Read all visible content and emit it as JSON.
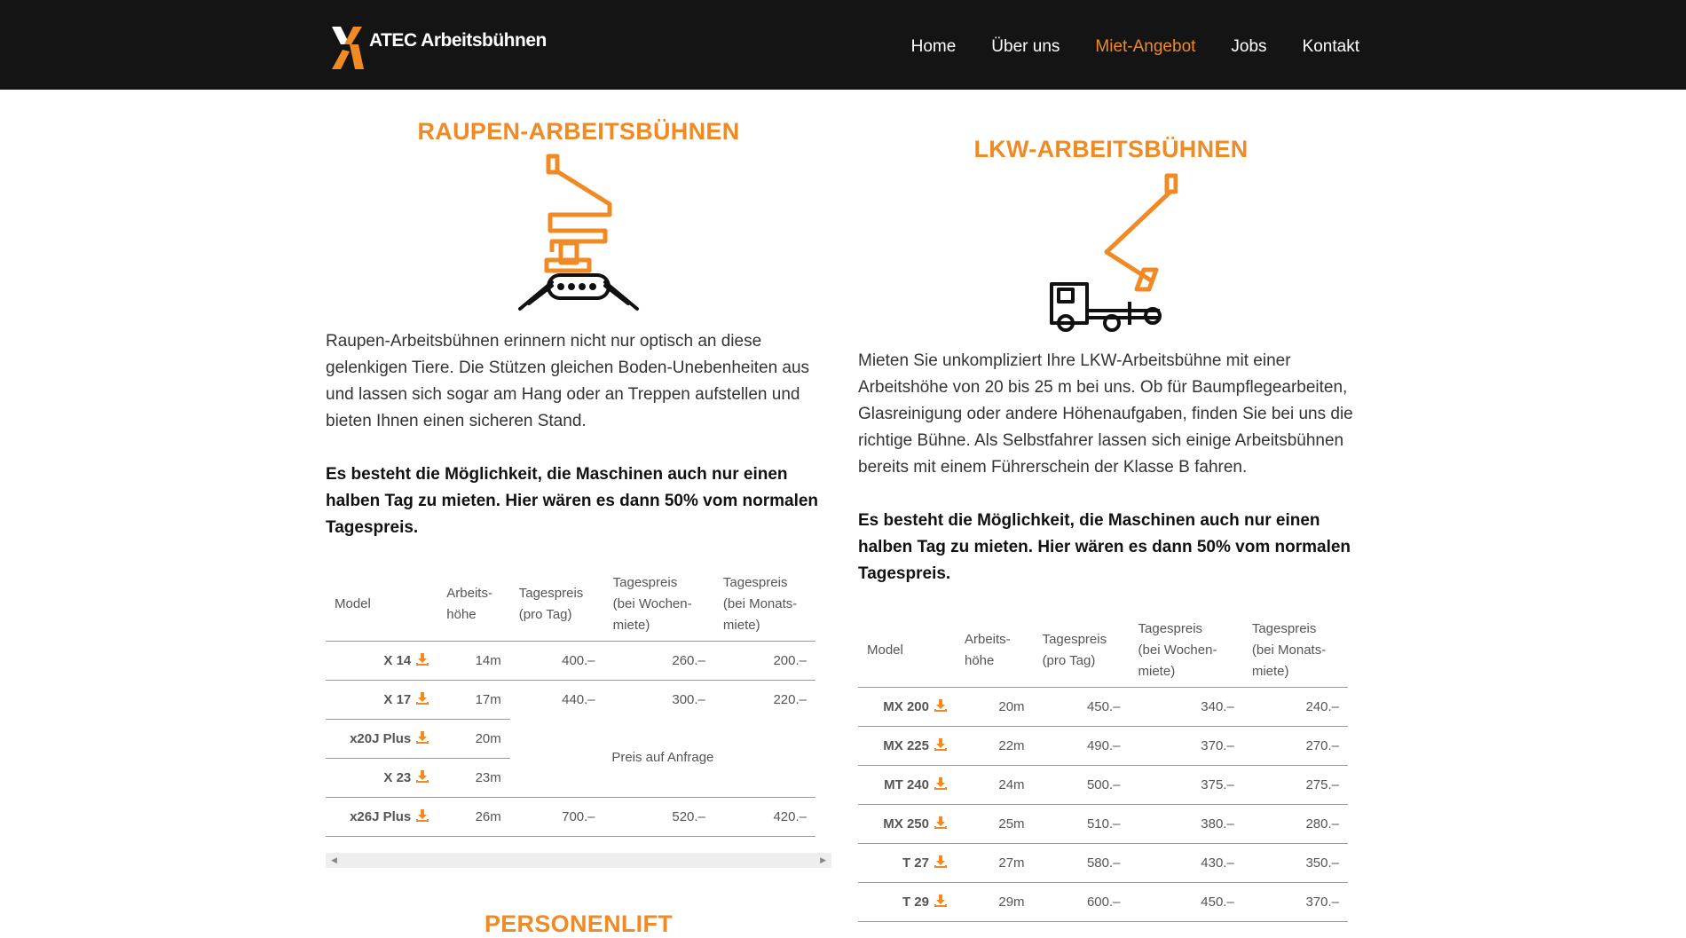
{
  "brand": {
    "name": "ATEC Arbeitsbühnen",
    "accent": "#f08a24",
    "dark": "#141414"
  },
  "nav": {
    "items": [
      {
        "label": "Home",
        "active": false
      },
      {
        "label": "Über uns",
        "active": false
      },
      {
        "label": "Miet-Angebot",
        "active": true
      },
      {
        "label": "Jobs",
        "active": false
      },
      {
        "label": "Kontakt",
        "active": false
      }
    ]
  },
  "raupen": {
    "title": "RAUPEN-ARBEITSBÜHNEN",
    "icon": "crawler-lift-icon",
    "text": "Raupen-Arbeitsbühnen erinnern nicht nur optisch an diese gelenkigen Tiere. Die Stützen gleichen Boden-Unebenheiten aus und lassen sich sogar am Hang oder an Treppen aufstellen und bieten Ihnen einen sicheren Stand.",
    "note": "Es besteht die Möglichkeit, die Maschinen auch nur einen halben Tag zu mieten. Hier wären es dann 50% vom normalen Tagespreis.",
    "table": {
      "headers": [
        "Model",
        "Arbeits-\nhöhe",
        "Tagespreis\n(pro Tag)",
        "Tagespreis\n(bei Wochen-\nmiete)",
        "Tagespreis\n(bei Monats-\nmiete)"
      ],
      "rows": [
        {
          "model": "X 14",
          "height": "14m",
          "day": "400.–",
          "week": "260.–",
          "month": "200.–"
        },
        {
          "model": "X 17",
          "height": "17m",
          "day": "440.–",
          "week": "300.–",
          "month": "220.–"
        },
        {
          "model": "x20J Plus",
          "height": "20m"
        },
        {
          "model": "X 23",
          "height": "23m"
        },
        {
          "model": "x26J Plus",
          "height": "26m",
          "day": "700.–",
          "week": "520.–",
          "month": "420.–"
        }
      ],
      "on_request": "Preis auf Anfrage"
    }
  },
  "lkw": {
    "title": "LKW-ARBEITSBÜHNEN",
    "icon": "truck-lift-icon",
    "text": "Mieten Sie unkompliziert Ihre LKW-Arbeitsbühne mit einer Arbeitshöhe von 20 bis 25 m bei uns. Ob für Baumpflegearbeiten, Glasreinigung oder andere Höhenaufgaben, finden Sie bei uns die richtige Bühne. Als Selbstfahrer lassen sich einige Arbeitsbühnen bereits mit einem Führerschein der Klasse B fahren.",
    "note": "Es besteht die Möglichkeit, die Maschinen auch nur einen halben Tag zu mieten. Hier wären es dann 50% vom normalen Tagespreis.",
    "table": {
      "headers": [
        "Model",
        "Arbeits-\nhöhe",
        "Tagespreis\n(pro Tag)",
        "Tagespreis\n(bei Wochen-\nmiete)",
        "Tagespreis\n(bei Monats-\nmiete)"
      ],
      "rows": [
        {
          "model": "MX 200",
          "height": "20m",
          "day": "450.–",
          "week": "340.–",
          "month": "240.–"
        },
        {
          "model": "MX 225",
          "height": "22m",
          "day": "490.–",
          "week": "370.–",
          "month": "270.–"
        },
        {
          "model": "MT 240",
          "height": "24m",
          "day": "500.–",
          "week": "375.–",
          "month": "275.–"
        },
        {
          "model": "MX 250",
          "height": "25m",
          "day": "510.–",
          "week": "380.–",
          "month": "280.–"
        },
        {
          "model": "T 27",
          "height": "27m",
          "day": "580.–",
          "week": "430.–",
          "month": "350.–"
        },
        {
          "model": "T 29",
          "height": "29m",
          "day": "600.–",
          "week": "450.–",
          "month": "370.–"
        }
      ]
    }
  },
  "personenlift": {
    "title": "PERSONENLIFT"
  }
}
